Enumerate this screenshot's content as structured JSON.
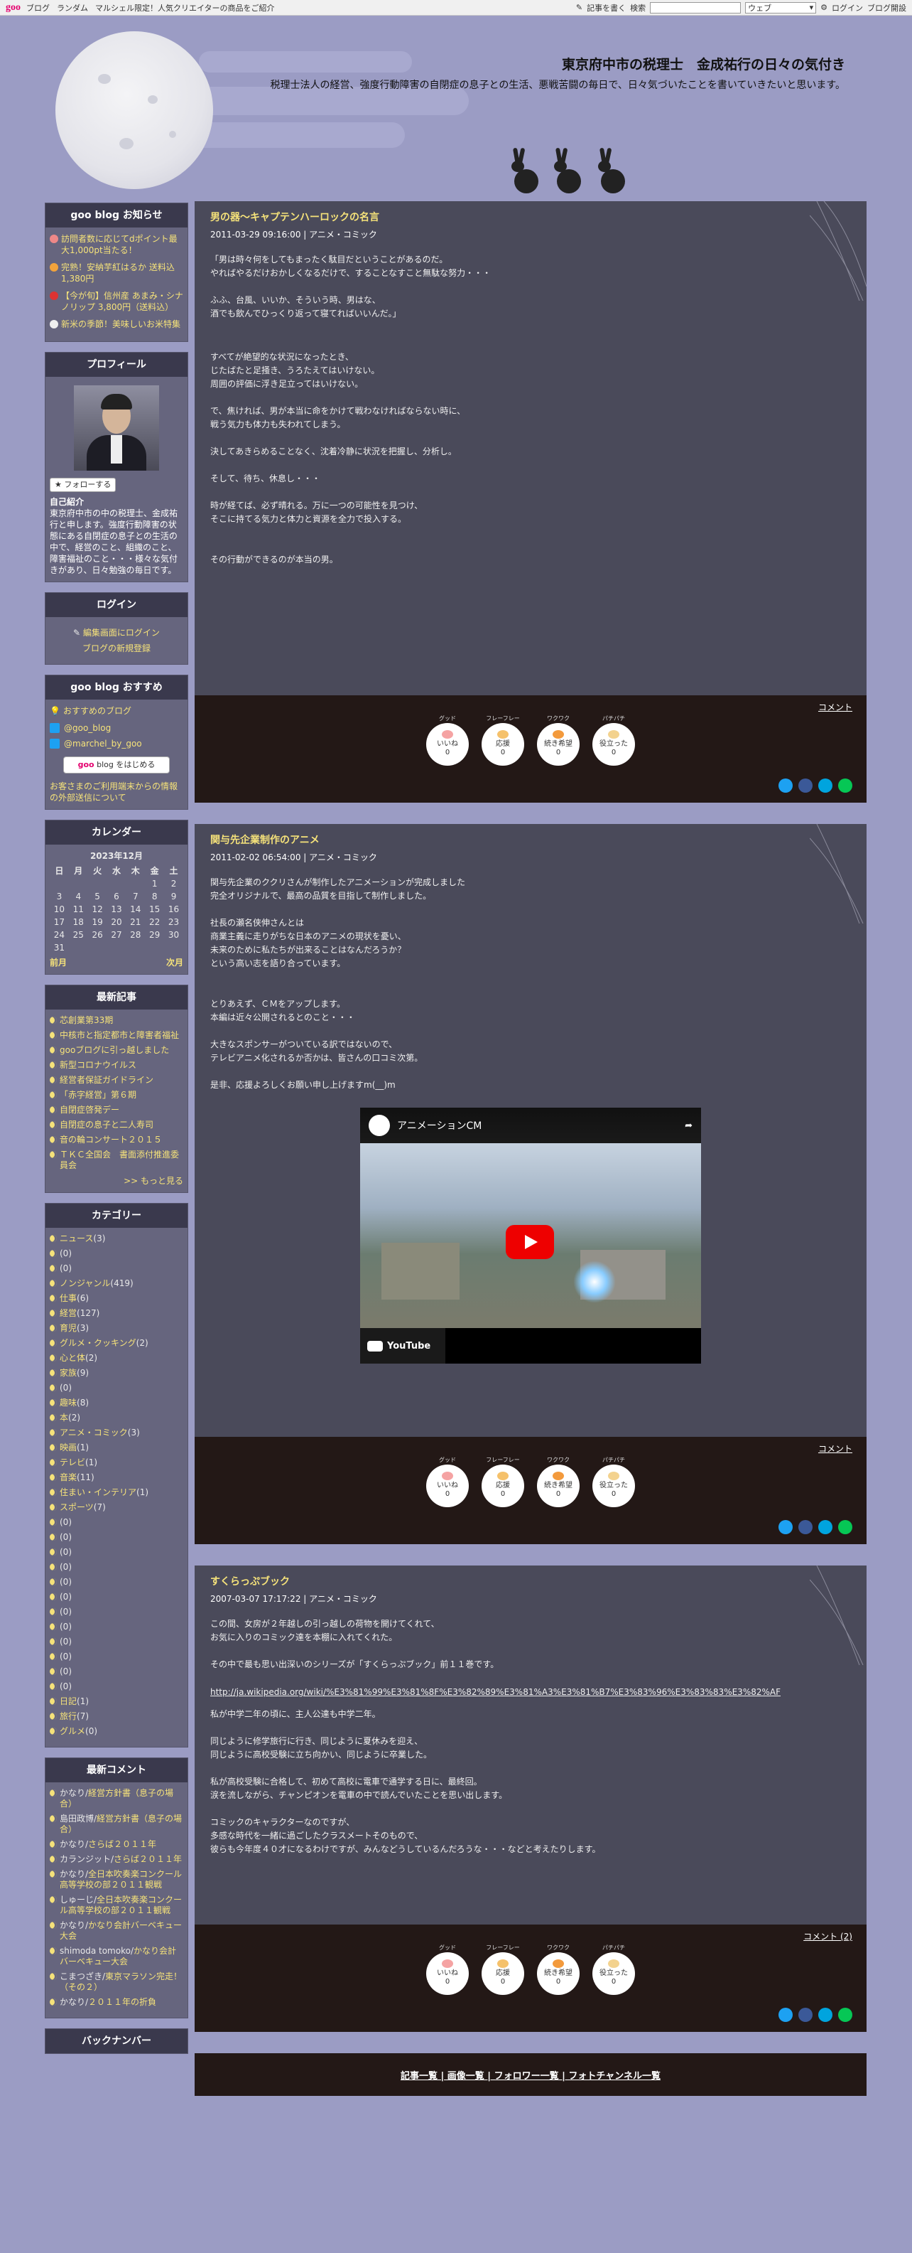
{
  "topbar": {
    "logo": "goo",
    "nav": [
      "ブログ",
      "ランダム",
      "マルシェル限定！人気クリエイターの商品をご紹介"
    ],
    "write_label": "記事を書く",
    "search_label": "検索",
    "search_placeholder": "",
    "search_scope": "ウェブ",
    "login_label": "ログイン",
    "open_blog_label": "ブログ開設"
  },
  "header": {
    "title": "東京府中市の税理士　金成祐行の日々の気付き",
    "description": "税理士法人の経営、強度行動障害の自閉症の息子との生活、悪戦苦闘の毎日で、日々気づいたことを書いていきたいと思います。"
  },
  "sidebar": {
    "notice": {
      "title": "goo blog お知らせ",
      "items": [
        "訪問者数に応じてdポイント最大1,000pt当たる！",
        "完熟！安納芋紅はるか 送料込1,380円",
        "【今が旬】信州産 あまみ・シナノリップ 3,800円（送料込）",
        "新米の季節！美味しいお米特集"
      ]
    },
    "profile": {
      "title": "プロフィール",
      "follow_label": "フォローする",
      "intro_heading": "自己紹介",
      "intro_text": "東京府中市の中の税理士、金成祐行と申します。強度行動障害の状態にある自閉症の息子との生活の中で、経営のこと、組織のこと、障害福祉のこと・・・様々な気付きがあり、日々勉強の毎日です。"
    },
    "login": {
      "title": "ログイン",
      "edit_link": "編集画面にログイン",
      "register_link": "ブログの新規登録"
    },
    "recommend": {
      "title": "goo blog おすすめ",
      "recommend_link": "おすすめのブログ",
      "twitter1": "@goo_blog",
      "twitter2": "@marchel_by_goo",
      "start_button_prefix": "goo",
      "start_button_suffix": "blog をはじめる",
      "external_link": "お客さまのご利用端末からの情報の外部送信について"
    },
    "calendar": {
      "title": "カレンダー",
      "month": "2023年12月",
      "weekdays": [
        "日",
        "月",
        "火",
        "水",
        "木",
        "金",
        "土"
      ],
      "weeks": [
        [
          "",
          "",
          "",
          "",
          "",
          "1",
          "2"
        ],
        [
          "3",
          "4",
          "5",
          "6",
          "7",
          "8",
          "9"
        ],
        [
          "10",
          "11",
          "12",
          "13",
          "14",
          "15",
          "16"
        ],
        [
          "17",
          "18",
          "19",
          "20",
          "21",
          "22",
          "23"
        ],
        [
          "24",
          "25",
          "26",
          "27",
          "28",
          "29",
          "30"
        ],
        [
          "31",
          "",
          "",
          "",
          "",
          "",
          ""
        ]
      ],
      "prev": "前月",
      "next": "次月"
    },
    "recent": {
      "title": "最新記事",
      "items": [
        "芯創業第33期",
        "中核市と指定都市と障害者福祉",
        "gooブログに引っ越しました",
        "新型コロナウイルス",
        "経営者保証ガイドライン",
        "「赤字経営」第６期",
        "自閉症啓発デー",
        "自閉症の息子と二人寿司",
        "音の輪コンサート２０１５",
        "ＴＫＣ全国会　書面添付推進委員会"
      ],
      "more": ">> もっと見る"
    },
    "categories": {
      "title": "カテゴリー",
      "items": [
        {
          "name": "ニュース",
          "count": "(3)"
        },
        {
          "name": "",
          "count": "(0)"
        },
        {
          "name": "",
          "count": "(0)"
        },
        {
          "name": "ノンジャンル",
          "count": "(419)"
        },
        {
          "name": "仕事",
          "count": "(6)"
        },
        {
          "name": "経営",
          "count": "(127)"
        },
        {
          "name": "育児",
          "count": "(3)"
        },
        {
          "name": "グルメ・クッキング",
          "count": "(2)"
        },
        {
          "name": "心と体",
          "count": "(2)"
        },
        {
          "name": "家族",
          "count": "(9)"
        },
        {
          "name": "",
          "count": "(0)"
        },
        {
          "name": "趣味",
          "count": "(8)"
        },
        {
          "name": "本",
          "count": "(2)"
        },
        {
          "name": "アニメ・コミック",
          "count": "(3)"
        },
        {
          "name": "映画",
          "count": "(1)"
        },
        {
          "name": "テレビ",
          "count": "(1)"
        },
        {
          "name": "音楽",
          "count": "(11)"
        },
        {
          "name": "住まい・インテリア",
          "count": "(1)"
        },
        {
          "name": "スポーツ",
          "count": "(7)"
        },
        {
          "name": "",
          "count": "(0)"
        },
        {
          "name": "",
          "count": "(0)"
        },
        {
          "name": "",
          "count": "(0)"
        },
        {
          "name": "",
          "count": "(0)"
        },
        {
          "name": "",
          "count": "(0)"
        },
        {
          "name": "",
          "count": "(0)"
        },
        {
          "name": "",
          "count": "(0)"
        },
        {
          "name": "",
          "count": "(0)"
        },
        {
          "name": "",
          "count": "(0)"
        },
        {
          "name": "",
          "count": "(0)"
        },
        {
          "name": "",
          "count": "(0)"
        },
        {
          "name": "",
          "count": "(0)"
        },
        {
          "name": "日記",
          "count": "(1)"
        },
        {
          "name": "旅行",
          "count": "(7)"
        },
        {
          "name": "グルメ",
          "count": "(0)"
        }
      ]
    },
    "comments": {
      "title": "最新コメント",
      "items": [
        {
          "who": "かなり/",
          "what": "経営方針書（息子の場合）"
        },
        {
          "who": "島田政博/",
          "what": "経営方針書（息子の場合）"
        },
        {
          "who": "かなり/",
          "what": "さらば２０１１年"
        },
        {
          "who": "カランジット/",
          "what": "さらば２０１１年"
        },
        {
          "who": "かなり/",
          "what": "全日本吹奏楽コンクール高等学校の部２０１１観戦"
        },
        {
          "who": "しゅーじ/",
          "what": "全日本吹奏楽コンクール高等学校の部２０１１観戦"
        },
        {
          "who": "かなり/",
          "what": "かなり会計バーベキュー大会"
        },
        {
          "who": "shimoda tomoko/",
          "what": "かなり会計バーベキュー大会"
        },
        {
          "who": "こまつざき/",
          "what": "東京マラソン完走！（その２）"
        },
        {
          "who": "かなり/",
          "what": "２０１１年の折負"
        }
      ]
    },
    "backnumber_title": "バックナンバー"
  },
  "posts": [
    {
      "title": "男の器～キャプテンハーロックの名言",
      "meta": "2011-03-29 09:16:00 | アニメ・コミック",
      "quote": "「男は時々何をしてもまったく駄目だということがあるのだ。\nやればやるだけおかしくなるだけで、することなすこと無駄な努力・・・\n\nふふ、台風、いいか、そういう時、男はな、\n酒でも飲んでひっくり返って寝てればいいんだ。」",
      "body": "すべてが絶望的な状況になったとき、\nじたばたと足掻き、うろたえてはいけない。\n周囲の評価に浮き足立ってはいけない。\n\nで、焦ければ、男が本当に命をかけて戦わなければならない時に、\n戦う気力も体力も失われてしまう。\n\n決してあきらめることなく、沈着冷静に状況を把握し、分析し。\n\nそして、待ち、休息し・・・\n\n時が経てば、必ず晴れる。万に一つの可能性を見つけ、\nそこに持てる気力と体力と資源を全力で投入する。\n\n\nその行動ができるのが本当の男。",
      "comment_label": "コメント"
    },
    {
      "title": "関与先企業制作のアニメ",
      "meta": "2011-02-02 06:54:00 | アニメ・コミック",
      "body": "関与先企業のククリさんが制作したアニメーションが完成しました\n完全オリジナルで、最高の品質を目指して制作しました。\n\n社長の瀬名侠伸さんとは\n商業主義に走りがちな日本のアニメの現状を憂い、\n未来のために私たちが出来ることはなんだろうか？\nという高い志を語り合っています。\n\n\nとりあえず、ＣＭをアップします。\n本編は近々公開されるとのこと・・・\n\n大きなスポンサーがついている訳ではないので、\nテレビアニメ化されるか否かは、皆さんの口コミ次第。\n\n是非、応援よろしくお願い申し上げますm(__)m",
      "video_title": "アニメーションCM",
      "video_brand": "YouTube",
      "comment_label": "コメント"
    },
    {
      "title": "すくらっぷブック",
      "meta": "2007-03-07 17:17:22 | アニメ・コミック",
      "body1": "この間、女房が２年越しの引っ越しの荷物を開けてくれて、\nお気に入りのコミック達を本棚に入れてくれた。\n\nその中で最も思い出深いのシリーズが「すくらっぷブック」前１１巻です。",
      "link": "http://ja.wikipedia.org/wiki/%E3%81%99%E3%81%8F%E3%82%89%E3%81%A3%E3%81%B7%E3%83%96%E3%83%83%E3%82%AF",
      "body2": "私が中学二年の頃に、主人公達も中学二年。\n\n同じように修学旅行に行き、同じように夏休みを迎え、\n同じように高校受験に立ち向かい、同じように卒業した。\n\n私が高校受験に合格して、初めて高校に電車で通学する日に、最終回。\n涙を流しながら、チャンピオンを電車の中で読んでいたことを思い出します。\n\nコミックのキャラクターなのですが、\n多感な時代を一緒に過ごしたクラスメートそのもので、\n彼らも今年度４０才になるわけですが、みんなどうしているんだろうな・・・などと考えたりします。",
      "comment_label": "コメント (2)"
    }
  ],
  "reactions": [
    {
      "kana": "グッド",
      "label": "いいね",
      "count": "0",
      "color": "#f5a3a3"
    },
    {
      "kana": "フレーフレー",
      "label": "応援",
      "count": "0",
      "color": "#f5c16b"
    },
    {
      "kana": "ワクワク",
      "label": "続き希望",
      "count": "0",
      "color": "#f39a3c"
    },
    {
      "kana": "パチパチ",
      "label": "役立った",
      "count": "0",
      "color": "#f3d28e"
    }
  ],
  "share_colors": [
    "#1da1f2",
    "#3b5998",
    "#00a4de",
    "#06c755"
  ],
  "footer_links": "記事一覧 | 画像一覧 | フォロワー一覧 | フォトチャンネル一覧"
}
